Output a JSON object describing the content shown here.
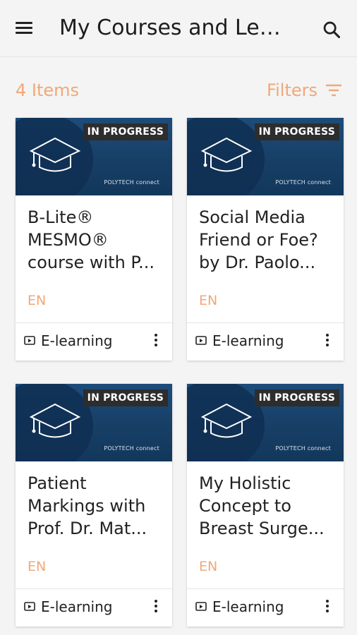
{
  "appbar": {
    "title": "My Courses and Learning",
    "menu_icon": "hamburger-menu-icon",
    "search_icon": "search-icon"
  },
  "list_header": {
    "count_label": "4 Items",
    "filters_label": "Filters",
    "filters_icon": "filter-icon"
  },
  "colors": {
    "accent": "#f1a877",
    "badge_bg": "#2d2d2d",
    "thumb_blue": "#1d4c7a"
  },
  "courses": [
    {
      "status": "IN PROGRESS",
      "brand": "POLYTECH connect",
      "title_lines": [
        "B-Lite®",
        "MESMO®",
        "course with P..."
      ],
      "language": "EN",
      "type": "E-learning"
    },
    {
      "status": "IN PROGRESS",
      "brand": "POLYTECH connect",
      "title_lines": [
        "Social Media",
        "Friend or Foe?",
        "by Dr. Paolo..."
      ],
      "language": "EN",
      "type": "E-learning"
    },
    {
      "status": "IN PROGRESS",
      "brand": "POLYTECH connect",
      "title_lines": [
        "Patient",
        "Markings with",
        "Prof. Dr. Mat..."
      ],
      "language": "EN",
      "type": "E-learning"
    },
    {
      "status": "IN PROGRESS",
      "brand": "POLYTECH connect",
      "title_lines": [
        "My Holistic",
        "Concept to",
        "Breast Surge..."
      ],
      "language": "EN",
      "type": "E-learning"
    }
  ]
}
